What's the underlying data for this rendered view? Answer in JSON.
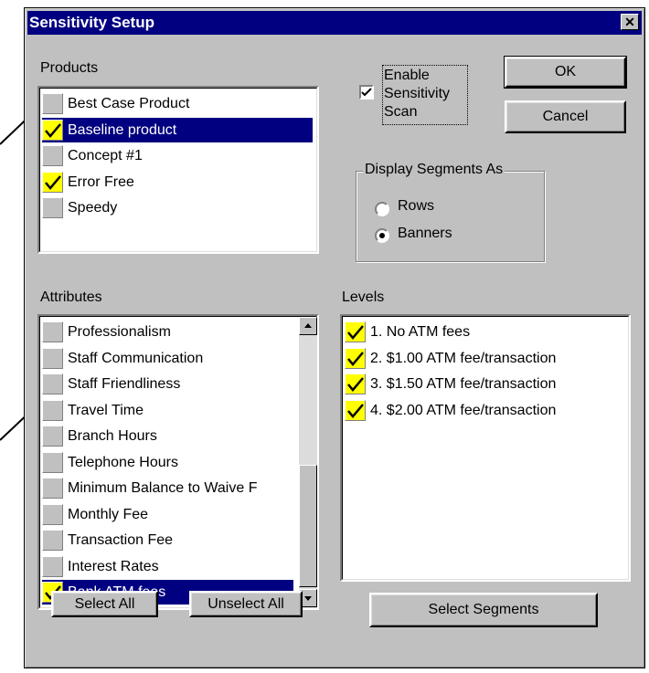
{
  "dialog": {
    "title": "Sensitivity Setup"
  },
  "products": {
    "label": "Products",
    "items": [
      {
        "label": "Best Case Product",
        "checked": false,
        "selected": false
      },
      {
        "label": "Baseline product",
        "checked": true,
        "selected": true
      },
      {
        "label": "Concept #1",
        "checked": false,
        "selected": false
      },
      {
        "label": "Error Free",
        "checked": true,
        "selected": false
      },
      {
        "label": "Speedy",
        "checked": false,
        "selected": false
      }
    ]
  },
  "sensitivity": {
    "line1": "Enable",
    "line2": "Sensitivity",
    "line3": "Scan",
    "checked": true
  },
  "buttons": {
    "ok": "OK",
    "cancel": "Cancel",
    "select_all": "Select All",
    "unselect_all": "Unselect All",
    "select_segments": "Select Segments"
  },
  "display_segments": {
    "label": "Display Segments As",
    "rows": "Rows",
    "banners": "Banners",
    "selected": "Banners"
  },
  "attributes": {
    "label": "Attributes",
    "items": [
      {
        "label": "Professionalism",
        "checked": false,
        "selected": false
      },
      {
        "label": "Staff Communication",
        "checked": false,
        "selected": false
      },
      {
        "label": "Staff Friendliness",
        "checked": false,
        "selected": false
      },
      {
        "label": "Travel Time",
        "checked": false,
        "selected": false
      },
      {
        "label": "Branch Hours",
        "checked": false,
        "selected": false
      },
      {
        "label": "Telephone Hours",
        "checked": false,
        "selected": false
      },
      {
        "label": "Minimum Balance to Waive F",
        "checked": false,
        "selected": false
      },
      {
        "label": "Monthly Fee",
        "checked": false,
        "selected": false
      },
      {
        "label": "Transaction Fee",
        "checked": false,
        "selected": false
      },
      {
        "label": "Interest Rates",
        "checked": false,
        "selected": false
      },
      {
        "label": "Bank ATM fees",
        "checked": true,
        "selected": true
      }
    ]
  },
  "levels": {
    "label": "Levels",
    "items": [
      {
        "label": "1. No ATM fees",
        "checked": true
      },
      {
        "label": "2. $1.00 ATM fee/transaction",
        "checked": true
      },
      {
        "label": "3. $1.50 ATM fee/transaction",
        "checked": true
      },
      {
        "label": "4. $2.00 ATM fee/transaction",
        "checked": true
      }
    ]
  },
  "colors": {
    "face": "#c0c0c0",
    "titlebar": "#000080",
    "selection": "#000080",
    "check_fill": "#ffff00"
  },
  "icons": {
    "close": "close-icon",
    "check": "check-icon",
    "scroll_up": "arrow-up-icon",
    "scroll_down": "arrow-down-icon"
  }
}
